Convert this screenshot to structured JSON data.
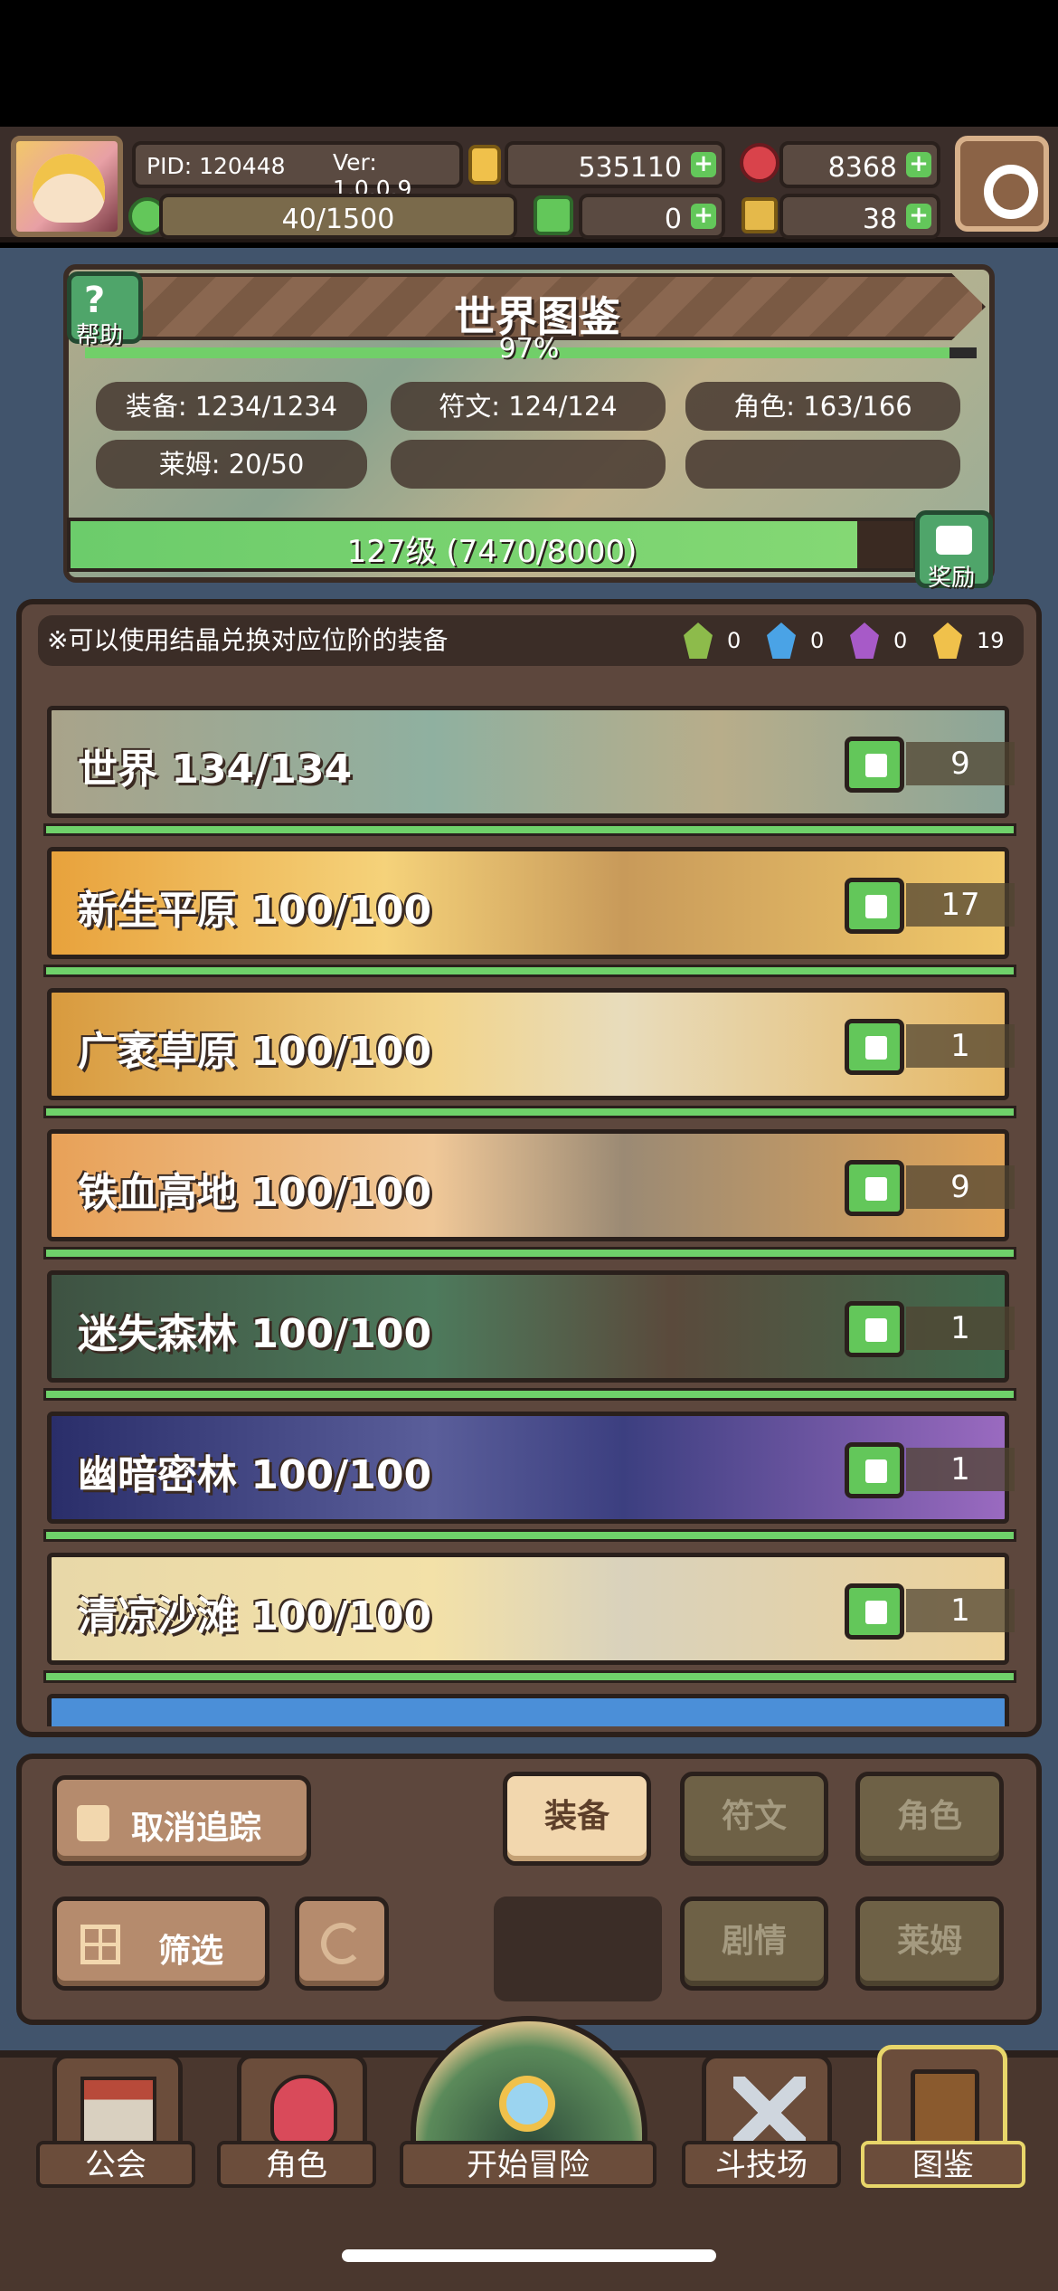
{
  "hud": {
    "pid": "PID: 120448",
    "version": "Ver: 1.0.0.9",
    "gold": "535110",
    "ruby": "8368",
    "stamina": "40/1500",
    "clover": "0",
    "key": "38"
  },
  "codex": {
    "title": "世界图鉴",
    "help_label": "帮助",
    "percent": "97%",
    "completion_fraction": 0.97,
    "stats": {
      "equipment": "装备: 1234/1234",
      "rune": "符文: 124/124",
      "character": "角色: 163/166",
      "slime": "莱姆: 20/50"
    },
    "level_text": "127级 (7470/8000)",
    "level_fraction": 0.934,
    "reward_label": "奖励"
  },
  "list": {
    "note": "※可以使用结晶兑换对应位阶的装备",
    "gems": [
      {
        "name": "green-crystal-icon",
        "color": "#8dbb4b",
        "count": "0"
      },
      {
        "name": "blue-crystal-icon",
        "color": "#4aa3e6",
        "count": "0"
      },
      {
        "name": "purple-crystal-icon",
        "color": "#a75ac8",
        "count": "0"
      },
      {
        "name": "gold-crystal-icon",
        "color": "#f0c14b",
        "count": "19"
      }
    ],
    "rows": [
      {
        "name": "世界",
        "progress": "134/134",
        "likes": "9"
      },
      {
        "name": "新生平原",
        "progress": "100/100",
        "likes": "17"
      },
      {
        "name": "广袤草原",
        "progress": "100/100",
        "likes": "1"
      },
      {
        "name": "铁血高地",
        "progress": "100/100",
        "likes": "9"
      },
      {
        "name": "迷失森林",
        "progress": "100/100",
        "likes": "1"
      },
      {
        "name": "幽暗密林",
        "progress": "100/100",
        "likes": "1"
      },
      {
        "name": "清凉沙滩",
        "progress": "100/100",
        "likes": "1"
      }
    ]
  },
  "controls": {
    "untrack": "取消追踪",
    "filter": "筛选",
    "tabs": {
      "equipment": "装备",
      "rune": "符文",
      "character": "角色",
      "story": "剧情",
      "slime": "莱姆"
    }
  },
  "nav": {
    "guild": "公会",
    "character": "角色",
    "adventure": "开始冒险",
    "arena": "斗技场",
    "codex": "图鉴"
  },
  "colors": {
    "accent_green": "#6fd16a",
    "panel_brown": "#5d473d",
    "selected_tab": "#f2d7ae"
  }
}
